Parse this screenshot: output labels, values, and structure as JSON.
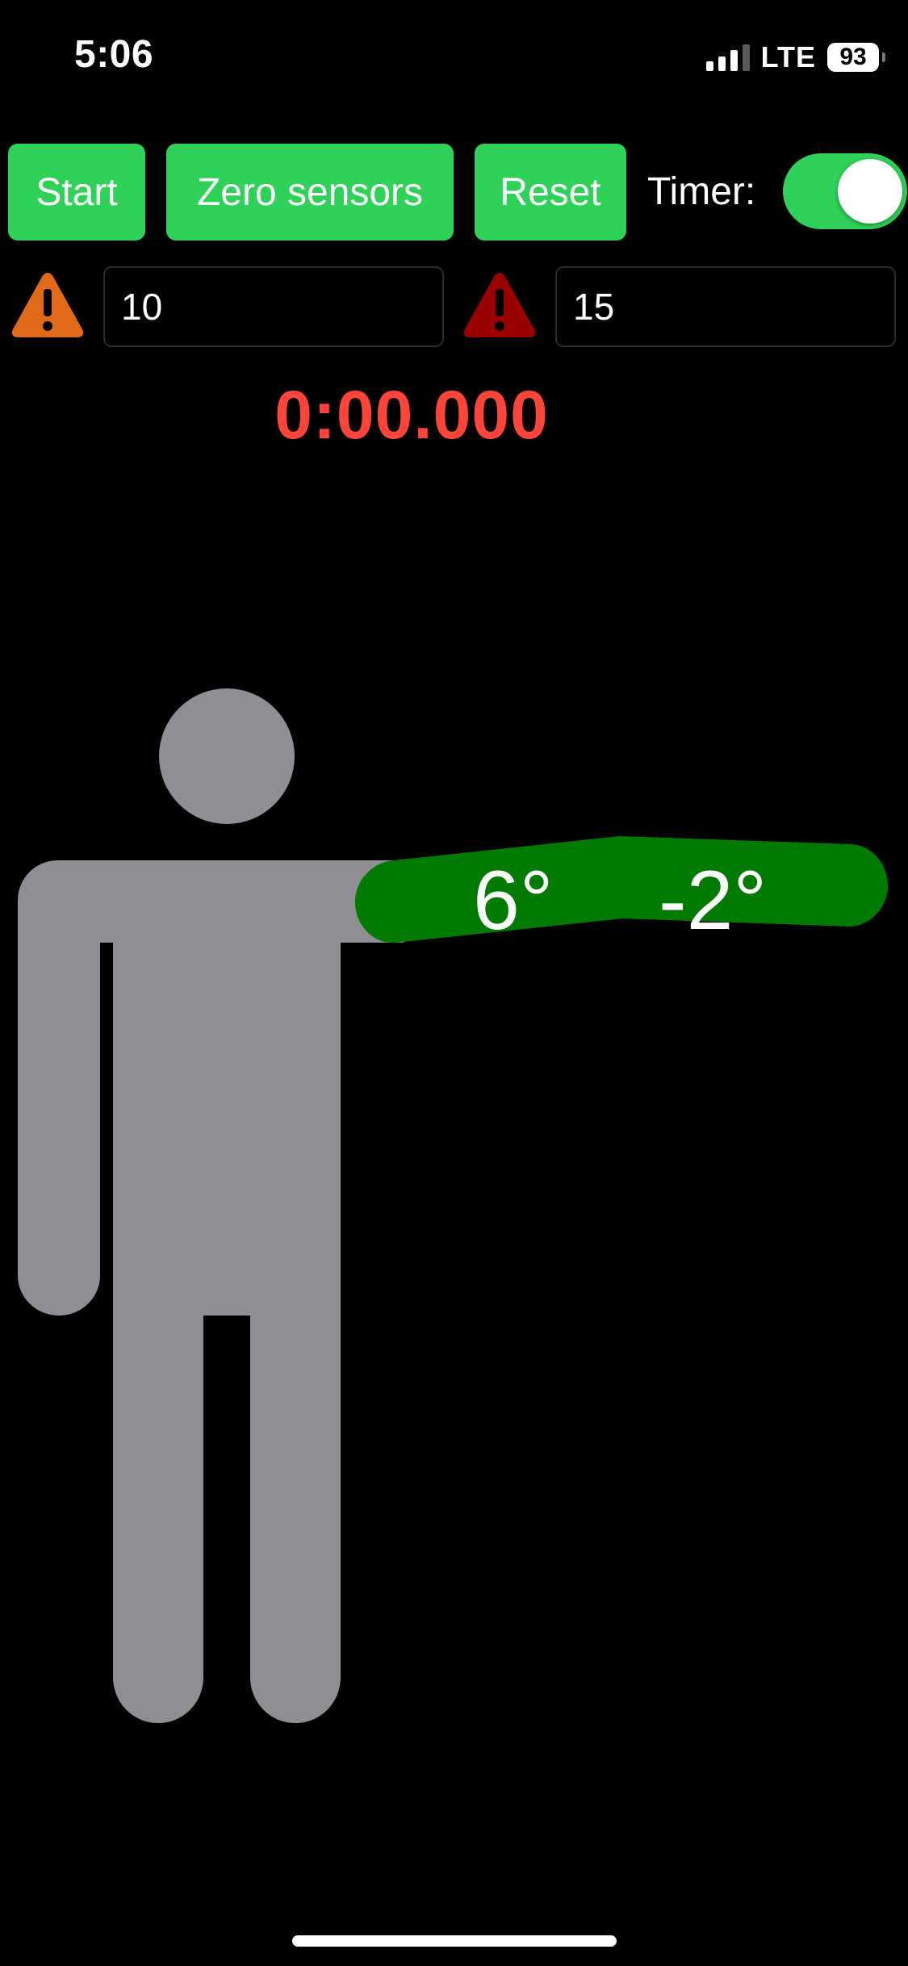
{
  "status_bar": {
    "time": "5:06",
    "network": "LTE",
    "battery": "93"
  },
  "controls": {
    "start_label": "Start",
    "zero_label": "Zero sensors",
    "reset_label": "Reset",
    "timer_label": "Timer:",
    "timer_toggle_on": true
  },
  "thresholds": {
    "warning_icon": "warning-triangle-orange",
    "warning_value": "10",
    "danger_icon": "warning-triangle-red",
    "danger_value": "15"
  },
  "timer": {
    "readout": "0:00.000"
  },
  "figure": {
    "upper_arm_angle": "6°",
    "forearm_angle": "-2°",
    "body_color": "#8e8e93",
    "arm_color": "#007a00"
  },
  "colors": {
    "accent_green": "#30d158",
    "timer_red": "#ff453a",
    "warn_orange": "#e06a1a",
    "danger_red": "#9b0000"
  }
}
